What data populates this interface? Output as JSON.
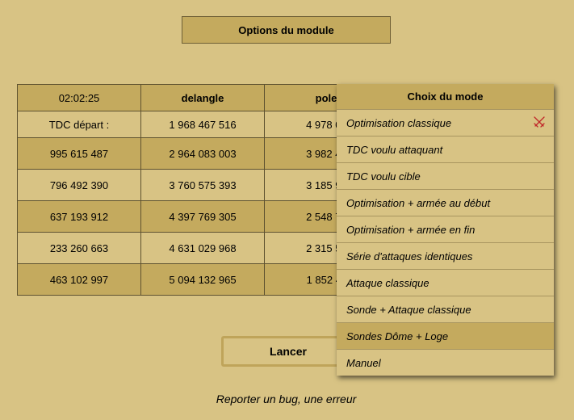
{
  "options_button": {
    "label": "Options du module"
  },
  "table": {
    "header": [
      "02:02:25",
      "delangle",
      "poleq"
    ],
    "start_row": [
      "TDC départ :",
      "1 968 467 516",
      "4 978 077"
    ],
    "rows": [
      [
        "995 615 487",
        "2 964 083 003",
        "3 982 461"
      ],
      [
        "796 492 390",
        "3 760 575 393",
        "3 185 969"
      ],
      [
        "637 193 912",
        "4 397 769 305",
        "2 548 775"
      ],
      [
        "233 260 663",
        "4 631 029 968",
        "2 315 514"
      ],
      [
        "463 102 997",
        "5 094 132 965",
        "1 852 411"
      ]
    ]
  },
  "launch_button": {
    "label": "Lancer"
  },
  "report_link": {
    "label": "Reporter un bug, une erreur"
  },
  "mode_menu": {
    "title": "Choix du mode",
    "items": [
      {
        "label": "Optimisation classique",
        "icon": "crossed-swords-icon"
      },
      {
        "label": "TDC voulu attaquant"
      },
      {
        "label": "TDC voulu cible"
      },
      {
        "label": "Optimisation + armée au début"
      },
      {
        "label": "Optimisation + armée en fin"
      },
      {
        "label": "Série d'attaques identiques"
      },
      {
        "label": "Attaque classique"
      },
      {
        "label": "Sonde + Attaque classique"
      },
      {
        "label": "Sondes Dôme + Loge",
        "selected": true
      },
      {
        "label": "Manuel"
      }
    ]
  },
  "colors": {
    "background": "#d8c384",
    "accent": "#c4aa5e",
    "icon_red": "#c0282a"
  }
}
